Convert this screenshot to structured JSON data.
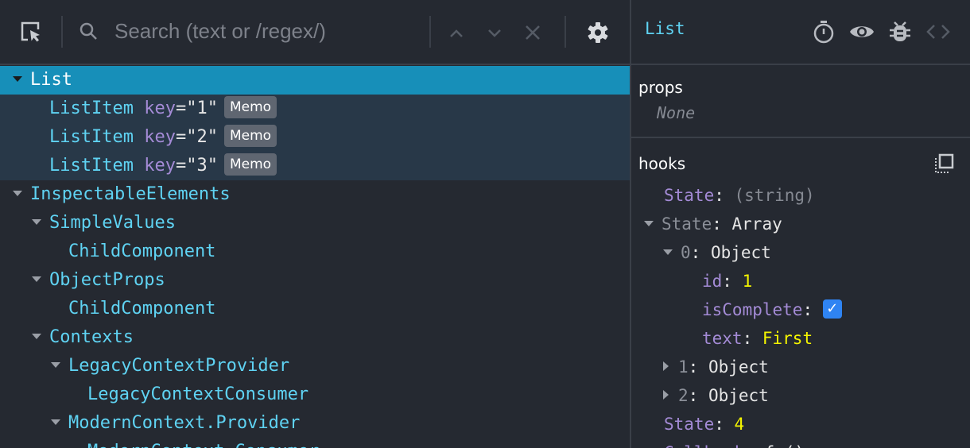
{
  "toolbar": {
    "search_placeholder": "Search (text or /regex/)",
    "icons": [
      "inspect-element-icon",
      "search-icon",
      "chevron-up-icon",
      "chevron-down-icon",
      "close-icon",
      "gear-icon"
    ]
  },
  "tree": [
    {
      "name": "List",
      "depth": 0,
      "expanded": true,
      "selected": true
    },
    {
      "name": "ListItem",
      "depth": 1,
      "key": "1",
      "badge": "Memo"
    },
    {
      "name": "ListItem",
      "depth": 1,
      "key": "2",
      "badge": "Memo"
    },
    {
      "name": "ListItem",
      "depth": 1,
      "key": "3",
      "badge": "Memo"
    },
    {
      "name": "InspectableElements",
      "depth": 0,
      "expanded": true
    },
    {
      "name": "SimpleValues",
      "depth": 1,
      "expanded": true
    },
    {
      "name": "ChildComponent",
      "depth": 2
    },
    {
      "name": "ObjectProps",
      "depth": 1,
      "expanded": true
    },
    {
      "name": "ChildComponent",
      "depth": 2
    },
    {
      "name": "Contexts",
      "depth": 1,
      "expanded": true
    },
    {
      "name": "LegacyContextProvider",
      "depth": 2,
      "expanded": true
    },
    {
      "name": "LegacyContextConsumer",
      "depth": 3
    },
    {
      "name": "ModernContext.Provider",
      "depth": 2,
      "expanded": true
    },
    {
      "name": "ModernContext.Consumer",
      "depth": 3
    }
  ],
  "key_attr": "key",
  "inspector": {
    "title": "List",
    "header_icons": [
      "stopwatch-icon",
      "eye-icon",
      "bug-icon",
      "code-icon"
    ],
    "props": {
      "title": "props",
      "empty": "None"
    },
    "hooks": {
      "title": "hooks",
      "copy_icon": "copy-icon",
      "rows": [
        {
          "depth": 0,
          "key": "State",
          "value": "(string)",
          "type": "muted"
        },
        {
          "depth": 0,
          "key": "State",
          "value": "Array",
          "expander": "expanded"
        },
        {
          "depth": 1,
          "key": "0",
          "value": "Object",
          "expander": "expanded"
        },
        {
          "depth": 2,
          "key": "id",
          "value": "1",
          "type": "number"
        },
        {
          "depth": 2,
          "key": "isComplete",
          "value": true,
          "type": "checkbox"
        },
        {
          "depth": 2,
          "key": "text",
          "value": "First",
          "type": "string"
        },
        {
          "depth": 1,
          "key": "1",
          "value": "Object",
          "expander": "collapsed"
        },
        {
          "depth": 1,
          "key": "2",
          "value": "Object",
          "expander": "collapsed"
        },
        {
          "depth": 0,
          "key": "State",
          "value": "4",
          "type": "number"
        },
        {
          "depth": 0,
          "key": "Callback",
          "value": "f ()",
          "type": "plain"
        }
      ]
    }
  },
  "colors": {
    "selected": "#178fb9",
    "component": "#5fd3f3",
    "attr": "#a48bd6",
    "number": "#f4f400",
    "checkbox": "#2f84f3"
  }
}
